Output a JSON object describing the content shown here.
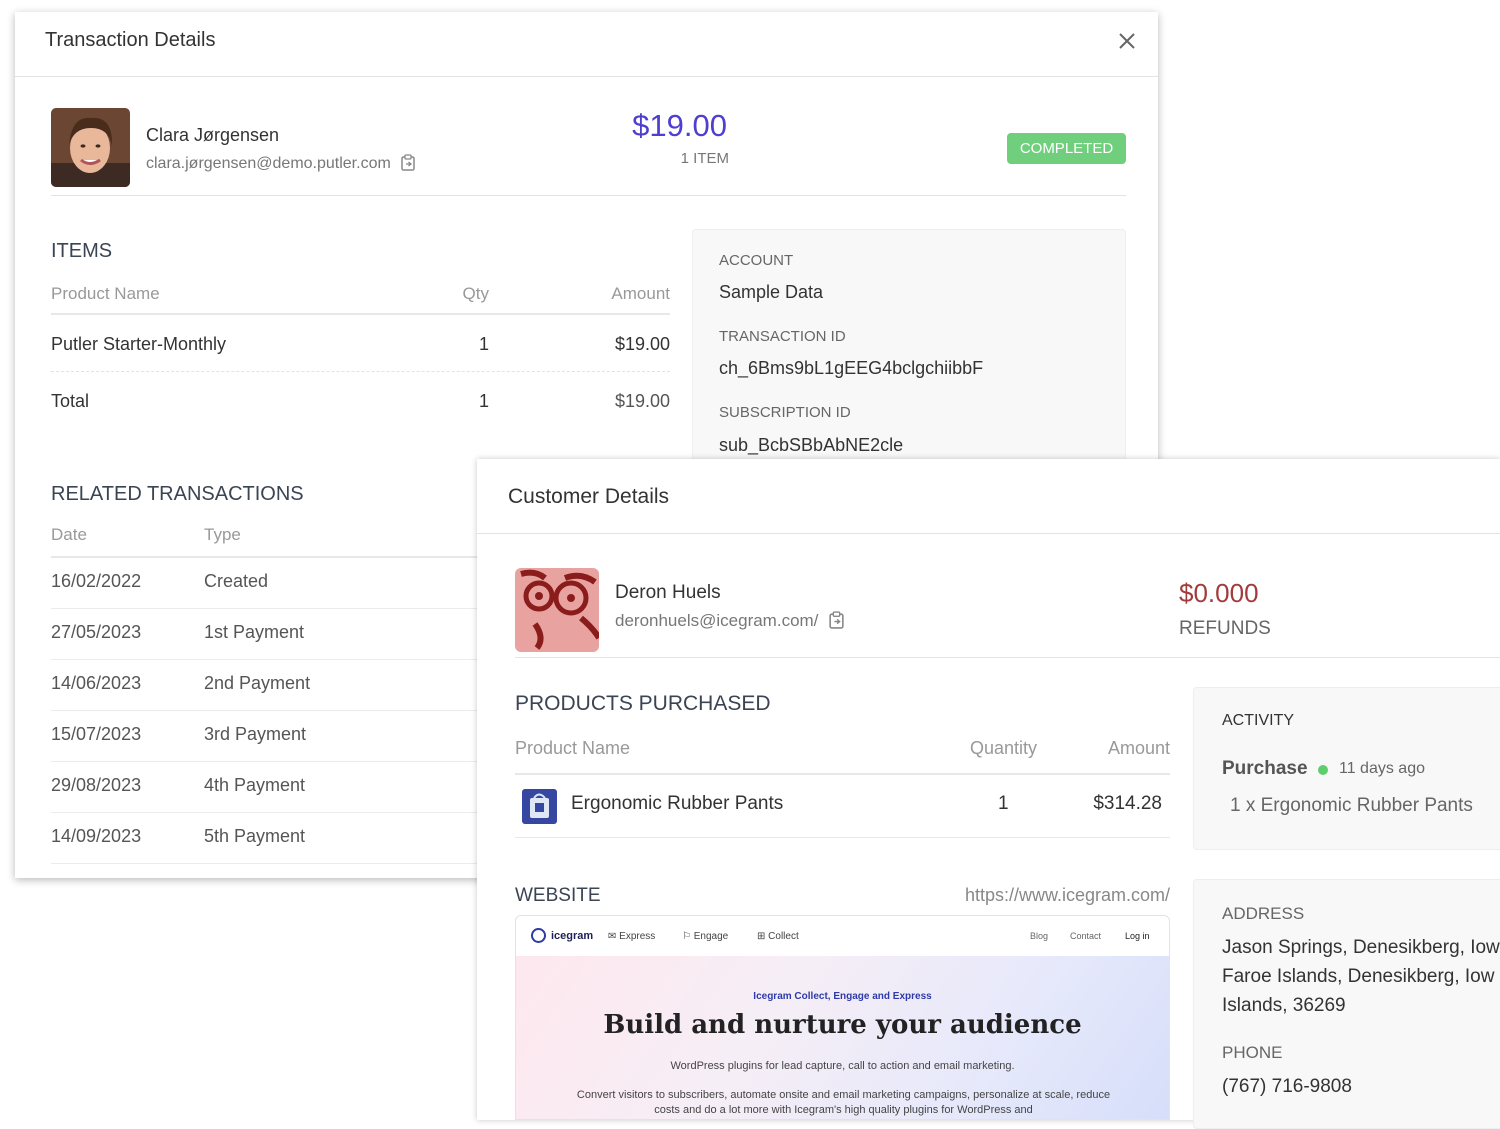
{
  "transaction_modal": {
    "title": "Transaction Details",
    "customer": {
      "name": "Clara Jørgensen",
      "email": "clara.jørgensen@demo.putler.com"
    },
    "amount": "$19.00",
    "items_count": "1 ITEM",
    "status": "COMPLETED",
    "status_color": "#6fcf7d",
    "amount_color": "#4f3fd0",
    "items": {
      "heading": "ITEMS",
      "columns": [
        "Product Name",
        "Qty",
        "Amount"
      ],
      "rows": [
        {
          "name": "Putler Starter-Monthly",
          "qty": "1",
          "amount": "$19.00"
        }
      ],
      "total": {
        "label": "Total",
        "qty": "1",
        "amount": "$19.00"
      }
    },
    "account": {
      "account_label": "ACCOUNT",
      "account_value": "Sample Data",
      "transaction_id_label": "TRANSACTION ID",
      "transaction_id_value": "ch_6Bms9bL1gEEG4bclgchiibbF",
      "subscription_id_label": "SUBSCRIPTION ID",
      "subscription_id_value": "sub_BcbSBbAbNE2cle"
    },
    "related_transactions": {
      "heading": "RELATED TRANSACTIONS",
      "columns": [
        "Date",
        "Type"
      ],
      "rows": [
        {
          "date": "16/02/2022",
          "type": "Created"
        },
        {
          "date": "27/05/2023",
          "type": "1st Payment"
        },
        {
          "date": "14/06/2023",
          "type": "2nd Payment"
        },
        {
          "date": "15/07/2023",
          "type": "3rd Payment"
        },
        {
          "date": "29/08/2023",
          "type": "4th Payment"
        },
        {
          "date": "14/09/2023",
          "type": "5th Payment"
        }
      ]
    }
  },
  "customer_modal": {
    "title": "Customer Details",
    "customer": {
      "name": "Deron Huels",
      "email": "deronhuels@icegram.com/"
    },
    "refunds_amount": "$0.000",
    "refunds_label": "REFUNDS",
    "refunds_color": "#a23b3b",
    "products": {
      "heading": "PRODUCTS PURCHASED",
      "columns": [
        "Product Name",
        "Quantity",
        "Amount"
      ],
      "rows": [
        {
          "name": "Ergonomic Rubber Pants",
          "qty": "1",
          "amount": "$314.28"
        }
      ]
    },
    "activity": {
      "label": "ACTIVITY",
      "type": "Purchase",
      "time": "11 days ago",
      "detail": "1 x Ergonomic Rubber Pants"
    },
    "website": {
      "heading": "WEBSITE",
      "url": "https://www.icegram.com/",
      "preview": {
        "logo": "icegram",
        "nav": [
          "Express",
          "Engage",
          "Collect"
        ],
        "nav_right": [
          "Blog",
          "Contact",
          "Log in"
        ],
        "kicker": "Icegram Collect, Engage and Express",
        "title": "Build and nurture your audience",
        "subtitle": "WordPress plugins for lead capture, call to action and email marketing.",
        "body": "Convert visitors to subscribers, automate onsite and email marketing campaigns, personalize at scale, reduce costs and do a lot more with Icegram's high quality plugins for WordPress and"
      }
    },
    "address": {
      "label": "ADDRESS",
      "lines": [
        "Jason Springs, Denesikberg, Iow",
        "Faroe Islands, Denesikberg, Iow",
        "Islands, 36269"
      ],
      "phone_label": "PHONE",
      "phone": "(767) 716-9808"
    }
  }
}
